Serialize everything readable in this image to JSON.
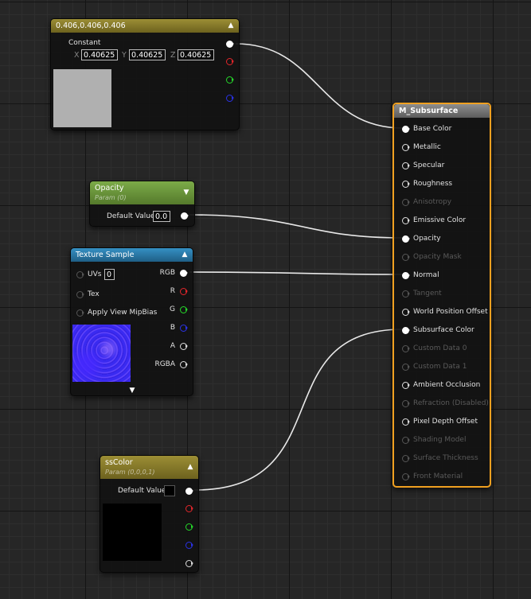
{
  "constant_node": {
    "title": "0.406,0.406,0.406",
    "label": "Constant",
    "x_label": "X",
    "x_value": "0.40625",
    "y_label": "Y",
    "y_value": "0.40625",
    "z_label": "Z",
    "z_value": "0.40625",
    "header_color": "#8d7f2a",
    "swatch_color": "#b0b0b0"
  },
  "opacity_node": {
    "title": "Opacity",
    "subtitle": "Param (0)",
    "default_label": "Default Value",
    "default_value": "0.0",
    "header_color": "#6c9640"
  },
  "texture_node": {
    "title": "Texture Sample",
    "header_color": "#2c7ba8",
    "uvs_label": "UVs",
    "uvs_value": "0",
    "tex_label": "Tex",
    "mipbias_label": "Apply View MipBias",
    "outputs": [
      "RGB",
      "R",
      "G",
      "B",
      "A",
      "RGBA"
    ]
  },
  "sscolor_node": {
    "title": "ssColor",
    "subtitle": "Param (0,0,0,1)",
    "default_label": "Default Value",
    "header_color": "#8d7f2a",
    "swatch_color": "#000000"
  },
  "material_node": {
    "title": "M_Subsurface",
    "border_color": "#f0a020",
    "inputs": [
      {
        "label": "Base Color",
        "enabled": true,
        "connected": true
      },
      {
        "label": "Metallic",
        "enabled": true,
        "connected": false
      },
      {
        "label": "Specular",
        "enabled": true,
        "connected": false
      },
      {
        "label": "Roughness",
        "enabled": true,
        "connected": false
      },
      {
        "label": "Anisotropy",
        "enabled": false,
        "connected": false
      },
      {
        "label": "Emissive Color",
        "enabled": true,
        "connected": false
      },
      {
        "label": "Opacity",
        "enabled": true,
        "connected": true
      },
      {
        "label": "Opacity Mask",
        "enabled": false,
        "connected": false
      },
      {
        "label": "Normal",
        "enabled": true,
        "connected": true
      },
      {
        "label": "Tangent",
        "enabled": false,
        "connected": false
      },
      {
        "label": "World Position Offset",
        "enabled": true,
        "connected": false
      },
      {
        "label": "Subsurface Color",
        "enabled": true,
        "connected": true
      },
      {
        "label": "Custom Data 0",
        "enabled": false,
        "connected": false
      },
      {
        "label": "Custom Data 1",
        "enabled": false,
        "connected": false
      },
      {
        "label": "Ambient Occlusion",
        "enabled": true,
        "connected": false
      },
      {
        "label": "Refraction (Disabled)",
        "enabled": false,
        "connected": false
      },
      {
        "label": "Pixel Depth Offset",
        "enabled": true,
        "connected": false
      },
      {
        "label": "Shading Model",
        "enabled": false,
        "connected": false
      },
      {
        "label": "Surface Thickness",
        "enabled": false,
        "connected": false
      },
      {
        "label": "Front Material",
        "enabled": false,
        "connected": false
      }
    ]
  },
  "icons": {
    "collapse": "chevron-up-icon",
    "expand": "chevron-down-icon"
  }
}
